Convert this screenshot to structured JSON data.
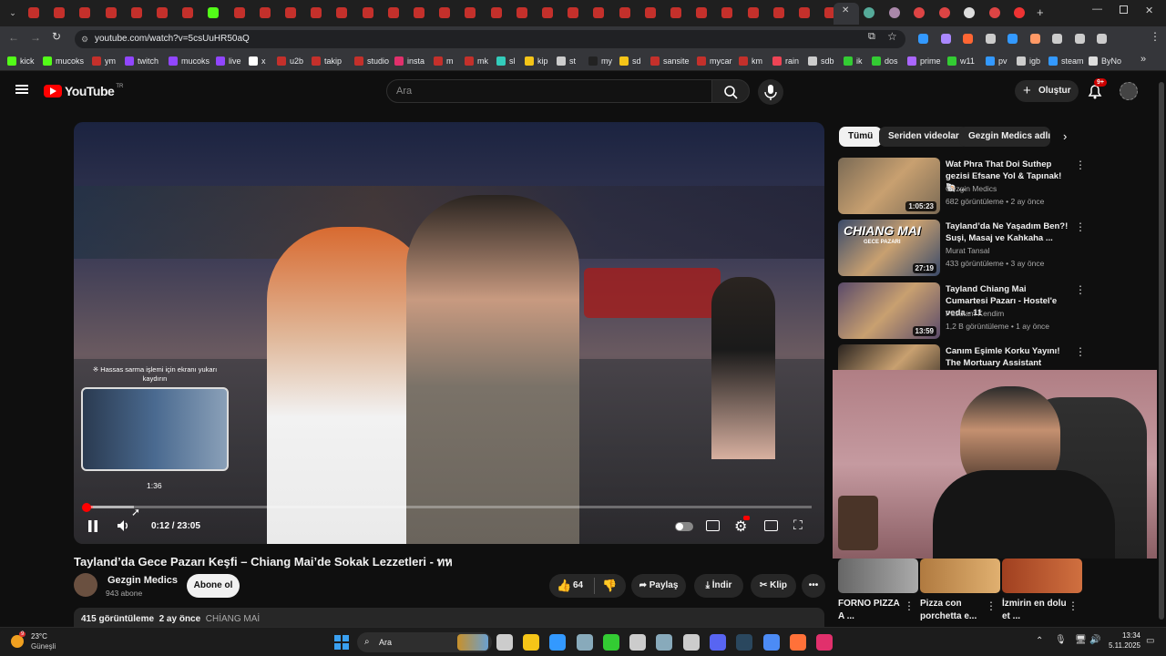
{
  "browser": {
    "url": "youtube.com/watch?v=5csUuHR50aQ",
    "bookmarks": [
      "kick",
      "mucoks",
      "ym",
      "twitch",
      "mucoks",
      "live",
      "x",
      "u2b",
      "takip",
      "studio",
      "insta",
      "m",
      "mk",
      "sl",
      "kip",
      "st",
      "my",
      "sd",
      "sansite",
      "mycar",
      "km",
      "rain",
      "sdb",
      "ik",
      "dos",
      "prime",
      "w11",
      "pv",
      "igb",
      "steam",
      "ByNo"
    ]
  },
  "header": {
    "logo": "YouTube",
    "logo_sup": "TR",
    "search_placeholder": "Ara",
    "create_label": "Oluştur",
    "notif_count": "9+"
  },
  "player": {
    "time": "0:12 / 23:05",
    "preview_time": "1:36",
    "hint": "※ Hassas sarma işlemi için ekranı yukarı kaydırın",
    "progress": 0.009
  },
  "video": {
    "title": "Tayland’da Gece Pazarı Keşfi – Chiang Mai’de Sokak Lezzetleri - ทห",
    "channel": "Gezgin Medics",
    "subs": "943 abone",
    "subscribe": "Abone ol",
    "likes": "64",
    "share": "Paylaş",
    "download": "İndir",
    "clip": "Klip",
    "views": "415 görüntüleme",
    "date": "2 ay önce",
    "tag": "CHİANG MAİ"
  },
  "chips": [
    "Tümü",
    "Seriden videolar",
    "Gezgin Medics adlı yü"
  ],
  "related": [
    {
      "title": "Wat Phra That Doi Suthep gezisi Efsane Yol & Tapınak! 🐚 ...",
      "channel": "Gezgin Medics",
      "meta": "682 görüntüleme • 2 ay önce",
      "duration": "1:05:23",
      "color": "#7a6a55"
    },
    {
      "title": "Tayland’da Ne Yaşadım Ben?! Suşi, Masaj ve Kahkaha ...",
      "channel": "Murat Tansal",
      "meta": "433 görüntüleme • 3 ay önce",
      "duration": "27:19",
      "color": "#3a4a6a",
      "thumb_text": "CHIANG MAI",
      "thumb_sub": "GECE PAZARI"
    },
    {
      "title": "Tayland Chiang Mai Cumartesi Pazarı - Hostel'e veda - 11",
      "channel": "Pusulam Kendim",
      "meta": "1,2 B görüntüleme • 1 ay önce",
      "duration": "13:59",
      "color": "#5a4a6a"
    },
    {
      "title": "Canım Eşimle Korku Yayını! The Mortuary Assistant Oynuyoruz...",
      "channel": "",
      "meta": "",
      "duration": "",
      "color": "#2a2420"
    }
  ],
  "mini": [
    {
      "title": "FORNO PIZZA A ..."
    },
    {
      "title": "Pizza con porchetta e..."
    },
    {
      "title": "İzmirin en dolu et ..."
    }
  ],
  "taskbar": {
    "weather_temp": "23°C",
    "weather_label": "Güneşli",
    "weather_badge": "9",
    "search": "Ara",
    "time": "13:34",
    "date": "5.11.2025"
  }
}
